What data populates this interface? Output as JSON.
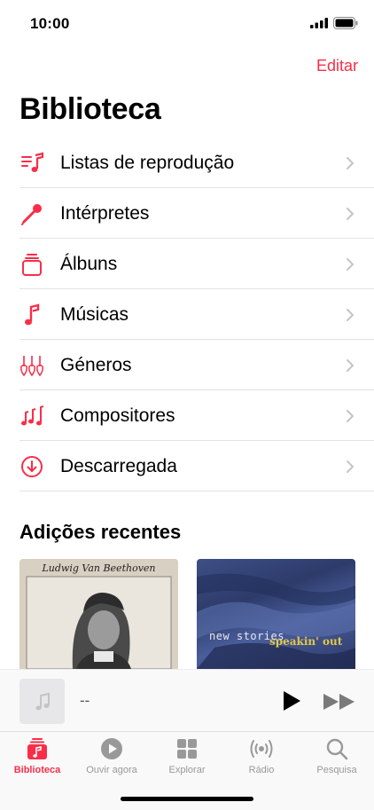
{
  "status": {
    "time": "10:00"
  },
  "header": {
    "edit_label": "Editar",
    "title": "Biblioteca"
  },
  "library": {
    "items": [
      {
        "label": "Listas de reprodução",
        "icon": "playlist-icon"
      },
      {
        "label": "Intérpretes",
        "icon": "microphone-icon"
      },
      {
        "label": "Álbuns",
        "icon": "album-stack-icon"
      },
      {
        "label": "Músicas",
        "icon": "music-note-icon"
      },
      {
        "label": "Géneros",
        "icon": "guitars-icon"
      },
      {
        "label": "Compositores",
        "icon": "music-notes-icon"
      },
      {
        "label": "Descarregada",
        "icon": "download-circle-icon"
      }
    ]
  },
  "recent": {
    "title": "Adições recentes",
    "albums": [
      {
        "cover_text": "Ludwig Van Beethoven"
      },
      {
        "cover_text": "new stories",
        "cover_text_2": "speakin' out"
      }
    ]
  },
  "mini_player": {
    "title": "--"
  },
  "tabs": [
    {
      "label": "Biblioteca",
      "icon": "library-icon",
      "active": true
    },
    {
      "label": "Ouvir agora",
      "icon": "play-circle-icon",
      "active": false
    },
    {
      "label": "Explorar",
      "icon": "grid-icon",
      "active": false
    },
    {
      "label": "Rádio",
      "icon": "radio-waves-icon",
      "active": false
    },
    {
      "label": "Pesquisa",
      "icon": "search-icon",
      "active": false
    }
  ],
  "colors": {
    "accent": "#fa2d48",
    "inactive": "#999999"
  }
}
